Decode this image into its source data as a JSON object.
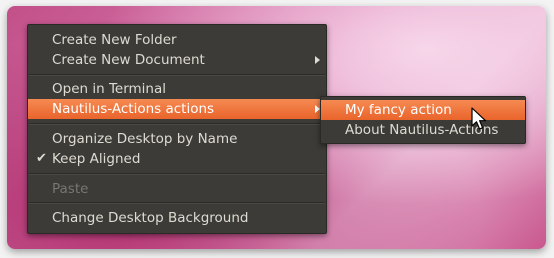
{
  "main_menu": {
    "items": [
      {
        "label": "Create New Folder"
      },
      {
        "label": "Create New Document",
        "submenu": true
      },
      {
        "label": "Open in Terminal"
      },
      {
        "label": "Nautilus-Actions actions",
        "submenu": true,
        "active": true
      },
      {
        "label": "Organize Desktop by Name"
      },
      {
        "label": "Keep Aligned",
        "checked": true
      },
      {
        "label": "Paste",
        "disabled": true
      },
      {
        "label": "Change Desktop Background"
      }
    ]
  },
  "sub_menu": {
    "items": [
      {
        "label": "My fancy action",
        "active": true
      },
      {
        "label": "About Nautilus-Actions"
      }
    ]
  },
  "icons": {
    "submenu_arrow": "triangle-right-icon",
    "check": "checkmark-icon",
    "cursor": "mouse-pointer-icon"
  },
  "colors": {
    "menu_bg": "#3c3b37",
    "highlight": "#f07746",
    "text": "#dfdbd2",
    "disabled_text": "#7a7670"
  }
}
